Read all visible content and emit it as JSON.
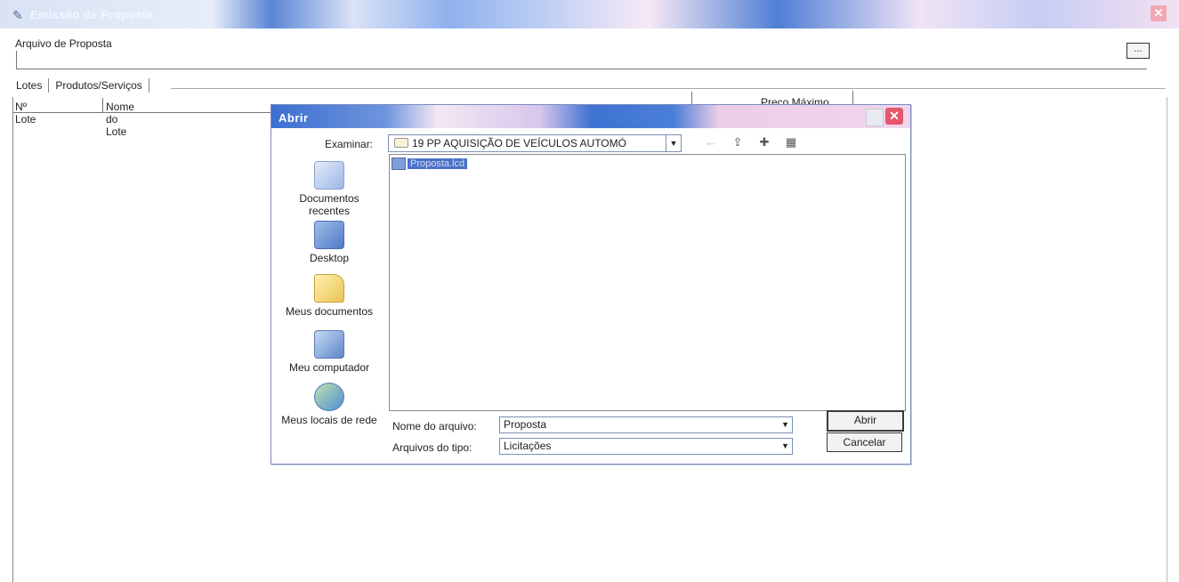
{
  "window": {
    "title": "Emissão de Proposta",
    "title_icon": "printer-icon",
    "close_glyph": "✕"
  },
  "file": {
    "label": "Arquivo de Proposta",
    "browse_label": "..."
  },
  "tabs": [
    {
      "label": "Lotes"
    },
    {
      "label": "Produtos/Serviços"
    }
  ],
  "grid": {
    "columns": [
      "Nº Lote",
      "Nome do Lote",
      "Preço Máximo"
    ]
  },
  "dialog": {
    "title": "Abrir",
    "close_glyph": "✕",
    "examinar_label": "Examinar:",
    "examinar_value": "19 PP AQUISIÇÃO DE VEÍCULOS AUTOMÓ",
    "places": [
      {
        "label": "Documentos recentes",
        "icon": "recent-documents-icon"
      },
      {
        "label": "Desktop",
        "icon": "desktop-icon"
      },
      {
        "label": "Meus documentos",
        "icon": "my-documents-icon"
      },
      {
        "label": "Meu computador",
        "icon": "my-computer-icon"
      },
      {
        "label": "Meus locais de rede",
        "icon": "network-places-icon"
      }
    ],
    "files": [
      {
        "name": "Proposta.lcd",
        "selected": true
      }
    ],
    "nome_label": "Nome do arquivo:",
    "nome_value": "Proposta",
    "tipo_label": "Arquivos do tipo:",
    "tipo_value": "Licitações",
    "open_button": "Abrir",
    "cancel_button": "Cancelar"
  },
  "colors": {
    "title_blue": "#3c6fd1",
    "close_red": "#e3566b",
    "selection": "#4b71c8"
  }
}
